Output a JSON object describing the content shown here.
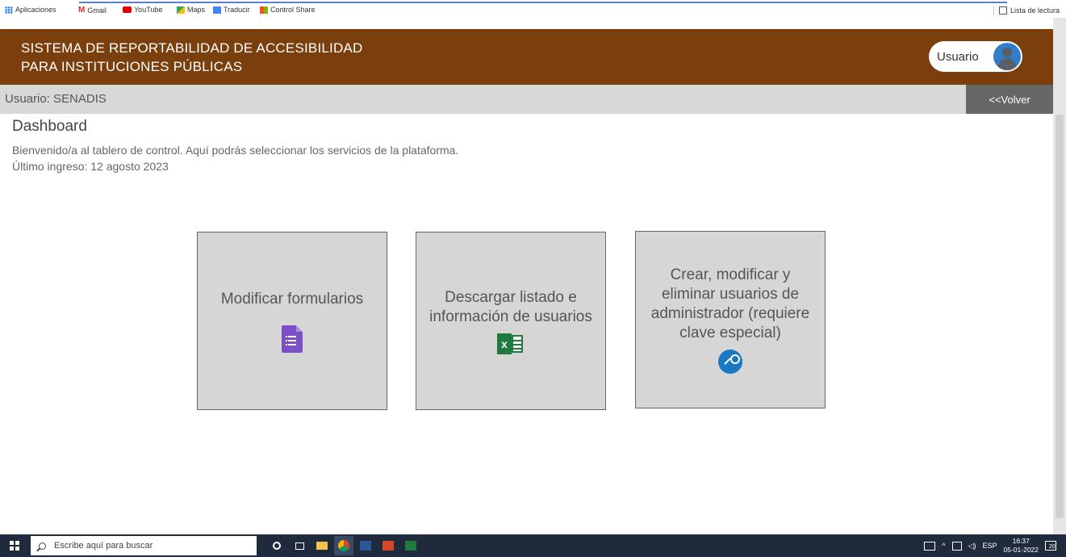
{
  "bookmarks": {
    "items": [
      {
        "label": "Aplicaciones",
        "icon": "apps-grid-icon",
        "color": "#1a73e8"
      },
      {
        "label": "Gmail",
        "icon": "gmail-icon",
        "color": "#d93025"
      },
      {
        "label": "YouTube",
        "icon": "youtube-icon",
        "color": "#e00000"
      },
      {
        "label": "Maps",
        "icon": "maps-icon",
        "color": "#34a853"
      },
      {
        "label": "Traducir",
        "icon": "translate-icon",
        "color": "#4285f4"
      },
      {
        "label": "Control Share",
        "icon": "windows-logo-icon",
        "color": "#f2b01e"
      }
    ],
    "reading_list": "Lista de lectura"
  },
  "header": {
    "title_line1": "SISTEMA DE REPORTABILIDAD DE ACCESIBILIDAD",
    "title_line2": "PARA INSTITUCIONES PÚBLICAS",
    "user_button": "Usuario",
    "brand_color": "#7a3f0c"
  },
  "subbar": {
    "user_text": "Usuario: SENADIS",
    "back_label": "<<Volver"
  },
  "dashboard": {
    "title": "Dashboard",
    "welcome": "Bienvenido/a  al tablero de control. Aquí podrás seleccionar los servicios de la plataforma.",
    "last_login": "Último ingreso: 12 agosto 2023"
  },
  "cards": [
    {
      "label": "Modificar formularios",
      "icon": "google-forms-icon"
    },
    {
      "label": "Descargar listado e información de usuarios",
      "icon": "excel-icon"
    },
    {
      "label": "Crear, modificar y eliminar usuarios de administrador (requiere clave especial)",
      "icon": "key-icon"
    }
  ],
  "taskbar": {
    "search_placeholder": "Escribe aquí para buscar",
    "language": "ESP",
    "time": "16:37",
    "date": "05-01-2022",
    "notifications": "20"
  }
}
